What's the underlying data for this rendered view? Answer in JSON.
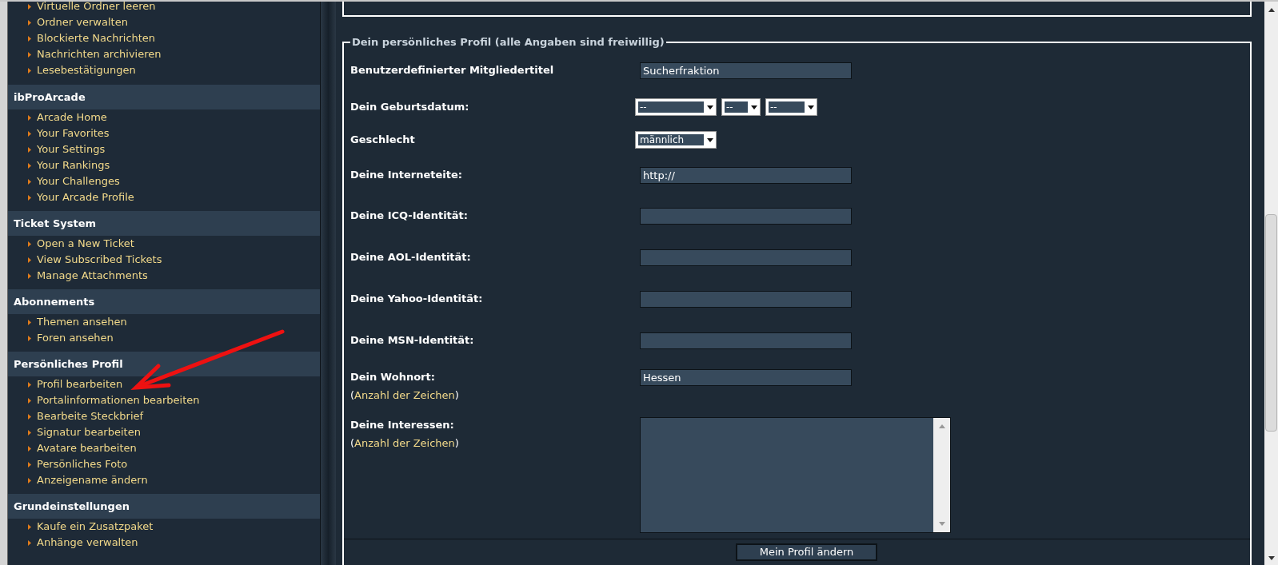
{
  "sidebar": {
    "sections": [
      {
        "items": [
          {
            "label": "Virtuelle Ordner leeren"
          },
          {
            "label": "Ordner verwalten"
          },
          {
            "label": "Blockierte Nachrichten"
          },
          {
            "label": "Nachrichten archivieren"
          },
          {
            "label": "Lesebestätigungen"
          }
        ]
      },
      {
        "title": "ibProArcade",
        "items": [
          {
            "label": "Arcade Home"
          },
          {
            "label": "Your Favorites"
          },
          {
            "label": "Your Settings"
          },
          {
            "label": "Your Rankings"
          },
          {
            "label": "Your Challenges"
          },
          {
            "label": "Your Arcade Profile"
          }
        ]
      },
      {
        "title": "Ticket System",
        "items": [
          {
            "label": "Open a New Ticket"
          },
          {
            "label": "View Subscribed Tickets"
          },
          {
            "label": "Manage Attachments"
          }
        ]
      },
      {
        "title": "Abonnements",
        "items": [
          {
            "label": "Themen ansehen"
          },
          {
            "label": "Foren ansehen"
          }
        ]
      },
      {
        "title": "Persönliches Profil",
        "items": [
          {
            "label": "Profil bearbeiten"
          },
          {
            "label": "Portalinformationen bearbeiten"
          },
          {
            "label": "Bearbeite Steckbrief"
          },
          {
            "label": "Signatur bearbeiten"
          },
          {
            "label": "Avatare bearbeiten"
          },
          {
            "label": "Persönliches Foto"
          },
          {
            "label": "Anzeigename ändern"
          }
        ]
      },
      {
        "title": "Grundeinstellungen",
        "items": [
          {
            "label": "Kaufe ein Zusatzpaket"
          },
          {
            "label": "Anhänge verwalten"
          }
        ]
      }
    ]
  },
  "profile_form": {
    "legend": "Dein persönliches Profil (alle Angaben sind freiwillig)",
    "fields": [
      {
        "kind": "text",
        "label": "Benutzerdefinierter Mitgliedertitel",
        "value": "Sucherfraktion"
      },
      {
        "kind": "date",
        "label": "Dein Geburtsdatum:",
        "values": [
          "--",
          "--",
          "--"
        ]
      },
      {
        "kind": "select",
        "label": "Geschlecht",
        "value": "männlich"
      },
      {
        "kind": "text",
        "label": "Deine Interneteite:",
        "value": "http://"
      },
      {
        "kind": "text",
        "label": "Deine ICQ-Identität:"
      },
      {
        "kind": "text",
        "label": "Deine AOL-Identität:"
      },
      {
        "kind": "text",
        "label": "Deine Yahoo-Identität:"
      },
      {
        "kind": "text",
        "label": "Deine MSN-Identität:"
      },
      {
        "kind": "text",
        "label": "Dein Wohnort:",
        "value": "Hessen",
        "note": {
          "prefix": "(",
          "link": "Anzahl der Zeichen",
          "suffix": ")"
        }
      },
      {
        "kind": "textarea",
        "label": "Deine Interessen:",
        "note": {
          "prefix": "(",
          "link": "Anzahl der Zeichen",
          "suffix": ")"
        }
      }
    ],
    "submit": "Mein Profil ändern"
  }
}
